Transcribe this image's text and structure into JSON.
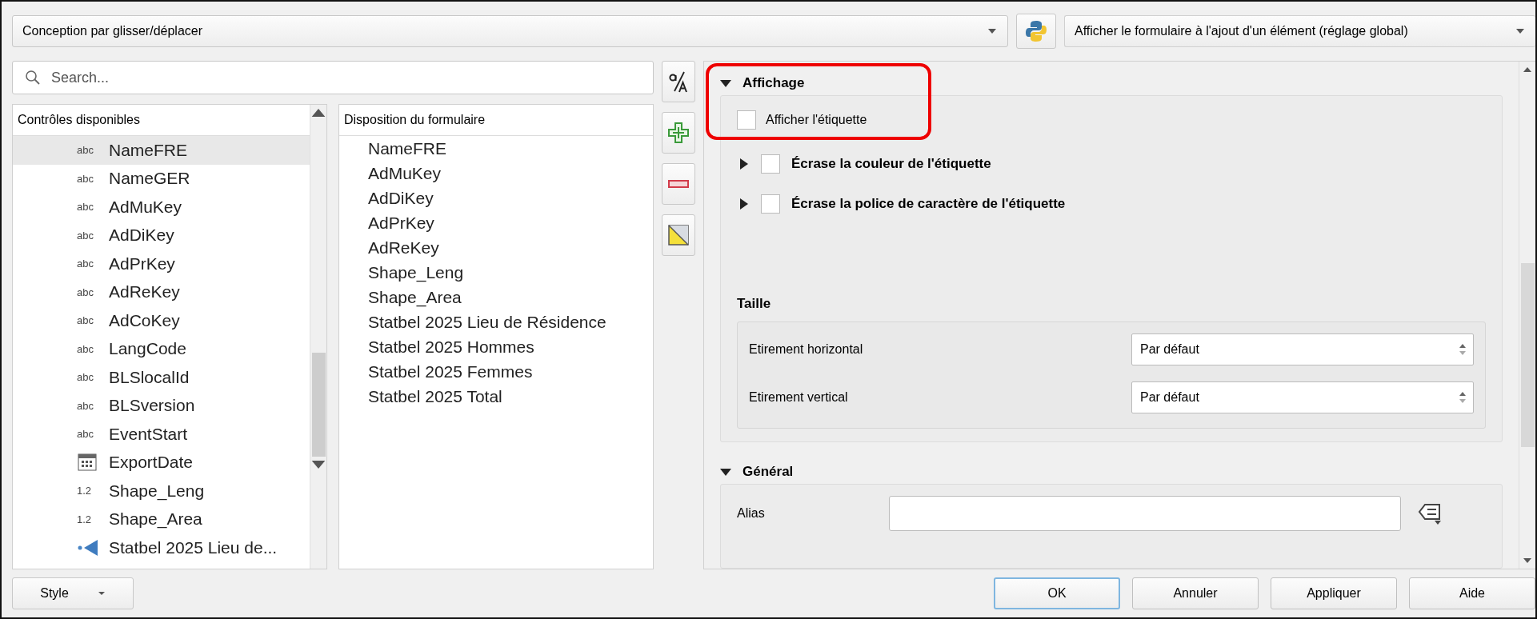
{
  "layout_selector": {
    "value": "Conception par glisser/déplacer"
  },
  "form_suppress": {
    "value": "Afficher le formulaire à l'ajout d'un élément (réglage global)"
  },
  "search": {
    "placeholder": "Search..."
  },
  "available_controls": {
    "header": "Contrôles disponibles",
    "items": [
      {
        "label": "NameFRE",
        "kind": "text",
        "badge": "abc",
        "selected": true
      },
      {
        "label": "NameGER",
        "kind": "text",
        "badge": "abc",
        "selected": false
      },
      {
        "label": "AdMuKey",
        "kind": "text",
        "badge": "abc",
        "selected": false
      },
      {
        "label": "AdDiKey",
        "kind": "text",
        "badge": "abc",
        "selected": false
      },
      {
        "label": "AdPrKey",
        "kind": "text",
        "badge": "abc",
        "selected": false
      },
      {
        "label": "AdReKey",
        "kind": "text",
        "badge": "abc",
        "selected": false
      },
      {
        "label": "AdCoKey",
        "kind": "text",
        "badge": "abc",
        "selected": false
      },
      {
        "label": "LangCode",
        "kind": "text",
        "badge": "abc",
        "selected": false
      },
      {
        "label": "BLSlocalId",
        "kind": "text",
        "badge": "abc",
        "selected": false
      },
      {
        "label": "BLSversion",
        "kind": "text",
        "badge": "abc",
        "selected": false
      },
      {
        "label": "EventStart",
        "kind": "text",
        "badge": "abc",
        "selected": false
      },
      {
        "label": "ExportDate",
        "kind": "date",
        "selected": false
      },
      {
        "label": "Shape_Leng",
        "kind": "number",
        "badge": "1.2",
        "selected": false
      },
      {
        "label": "Shape_Area",
        "kind": "number",
        "badge": "1.2",
        "selected": false
      },
      {
        "label": "Statbel 2025 Lieu de...",
        "kind": "relation",
        "selected": false
      }
    ]
  },
  "form_layout": {
    "header": "Disposition du formulaire",
    "items": [
      {
        "label": "NameFRE",
        "selected": false
      },
      {
        "label": "AdMuKey",
        "selected": false
      },
      {
        "label": "AdDiKey",
        "selected": false
      },
      {
        "label": "AdPrKey",
        "selected": false
      },
      {
        "label": "AdReKey",
        "selected": false
      },
      {
        "label": "Shape_Leng",
        "selected": false
      },
      {
        "label": "Shape_Area",
        "selected": false
      },
      {
        "label": "Statbel 2025 Lieu de Résidence",
        "selected": false
      },
      {
        "label": "Statbel 2025 Hommes",
        "selected": false
      },
      {
        "label": "Statbel 2025 Femmes",
        "selected": false
      },
      {
        "label": "Statbel 2025 Total",
        "selected": false
      }
    ]
  },
  "display": {
    "title": "Affichage",
    "expanded": true,
    "highlighted": true,
    "show_label": {
      "label": "Afficher l'étiquette",
      "checked": false
    },
    "overrides": [
      {
        "label": "Écrase la couleur de l'étiquette",
        "checked": false,
        "expanded": false
      },
      {
        "label": "Écrase la police de caractère de l'étiquette",
        "checked": false,
        "expanded": false
      }
    ],
    "size": {
      "title": "Taille",
      "rows": [
        {
          "label": "Etirement horizontal",
          "value": "Par défaut"
        },
        {
          "label": "Etirement vertical",
          "value": "Par défaut"
        }
      ]
    }
  },
  "general": {
    "title": "Général",
    "expanded": true,
    "alias": {
      "label": "Alias"
    }
  },
  "style_button": {
    "label": "Style"
  },
  "buttons": [
    {
      "label": "OK",
      "default": true
    },
    {
      "label": "Annuler",
      "default": false
    },
    {
      "label": "Appliquer",
      "default": false
    },
    {
      "label": "Aide",
      "default": false
    }
  ]
}
